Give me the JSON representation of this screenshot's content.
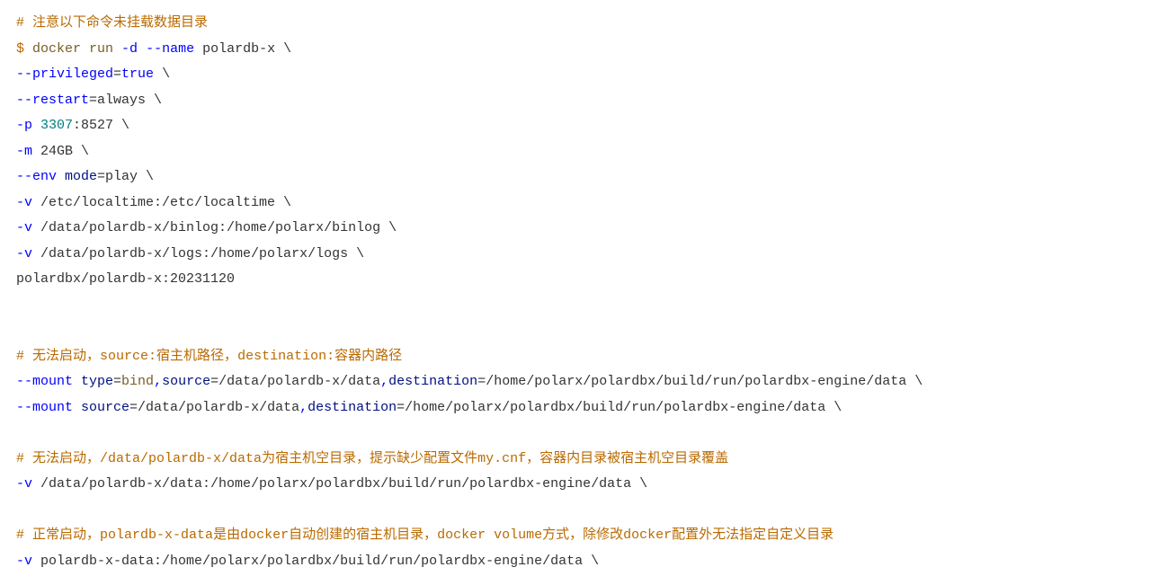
{
  "code": {
    "l1_hash": "#",
    "l1_text": " 注意以下命令未挂载数据目录",
    "l2_dollar": "$",
    "l2_docker": " docker",
    "l2_run": " run",
    "l2_d": " -d",
    "l2_name": " --name",
    "l2_rest": " polardb-x \\",
    "l3_flag": "--privileged",
    "l3_eq": "=",
    "l3_val": "true",
    "l3_bs": " \\",
    "l4_flag": "--restart",
    "l4_eq": "=",
    "l4_val": "always \\",
    "l5_flag": "-p",
    "l5_port1": " 3307",
    "l5_colon": ":8527 \\",
    "l6_flag": "-m",
    "l6_rest": " 24GB \\",
    "l7_flag": "--env",
    "l7_mode": " mode",
    "l7_eq": "=",
    "l7_val": "play \\",
    "l8_flag": "-v",
    "l8_rest": " /etc/localtime:/etc/localtime \\",
    "l9_flag": "-v",
    "l9_rest": " /data/polardb-x/binlog:/home/polarx/binlog \\",
    "l10_flag": "-v",
    "l10_rest": " /data/polardb-x/logs:/home/polarx/logs \\",
    "l11": "polardbx/polardb-x:20231120",
    "l12_hash": "#",
    "l12_a": " 无法启动，",
    "l12_src": "source:",
    "l12_b": "宿主机路径，",
    "l12_dst": "destination:",
    "l12_c": "容器内路径",
    "l13_flag": "--mount",
    "l13_type": " type",
    "l13_eq1": "=",
    "l13_bind": "bind",
    "l13_comma1": ",",
    "l13_srcK": "source",
    "l13_eq2": "=",
    "l13_srcV": "/data/polardb-x/data",
    "l13_comma2": ",",
    "l13_dstK": "destination",
    "l13_eq3": "=",
    "l13_dstV": "/home/polarx/polardbx/build/run/polardbx-engine/data \\",
    "l14_flag": "--mount",
    "l14_srcK": " source",
    "l14_eq1": "=",
    "l14_srcV": "/data/polardb-x/data",
    "l14_comma": ",",
    "l14_dstK": "destination",
    "l14_eq2": "=",
    "l14_dstV": "/home/polarx/polardbx/build/run/polardbx-engine/data \\",
    "l15_hash": "#",
    "l15_a": " 无法启动，",
    "l15_b": "/data/polardb-x/data",
    "l15_c": "为宿主机空目录，提示缺少配置文件",
    "l15_d": "my.cnf",
    "l15_e": "，容器内目录被宿主机空目录覆盖",
    "l16_flag": "-v",
    "l16_rest": " /data/polardb-x/data:/home/polarx/polardbx/build/run/polardbx-engine/data \\",
    "l17_hash": "#",
    "l17_a": " 正常启动，",
    "l17_b": "polardb-x-data",
    "l17_c": "是由",
    "l17_d": "docker",
    "l17_e": "自动创建的宿主机目录，",
    "l17_f": "docker volume",
    "l17_g": "方式，除修改",
    "l17_h": "docker",
    "l17_i": "配置外无法指定自定义目录",
    "l18_flag": "-v",
    "l18_rest": " polardb-x-data:/home/polarx/polardbx/build/run/polardbx-engine/data \\"
  }
}
